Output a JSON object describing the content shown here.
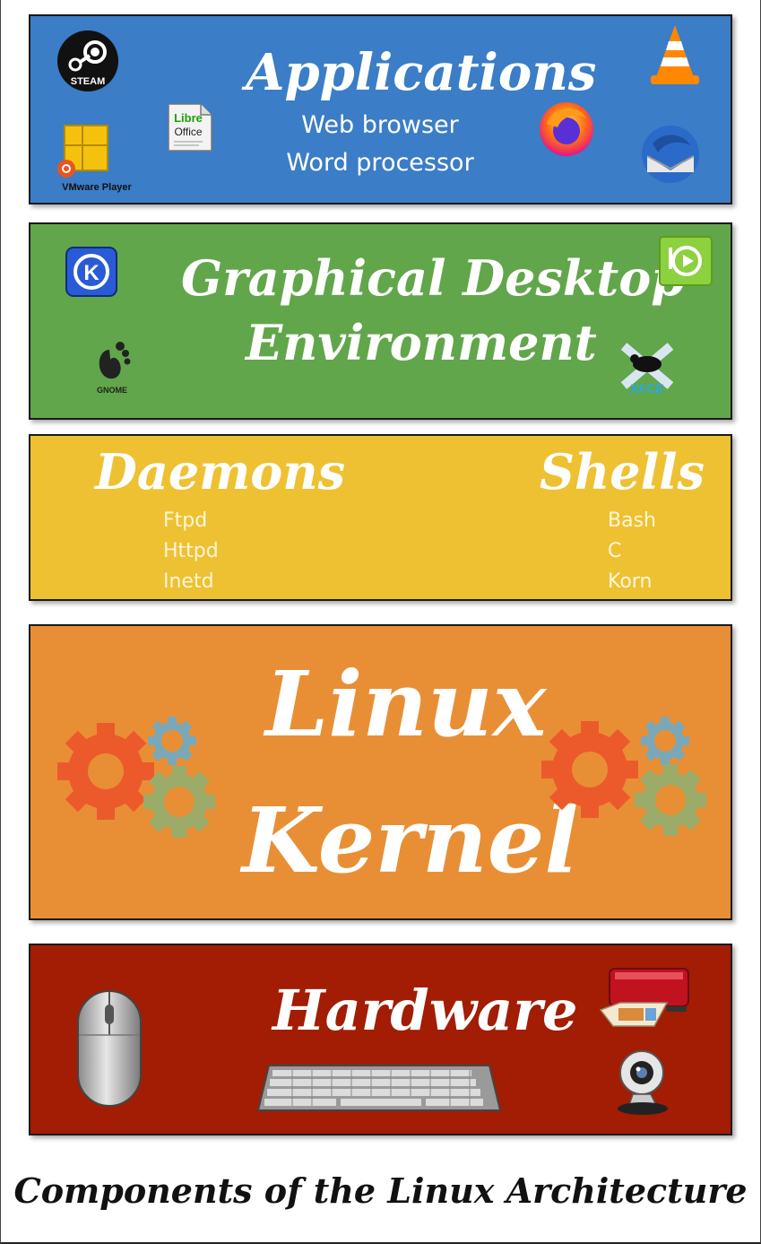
{
  "applications": {
    "title": "Applications",
    "items": [
      "Web browser",
      "Word processor"
    ],
    "steam_label": "STEAM",
    "libre_label": "Libre",
    "office_label": "Office",
    "vmware_label": "VMware Player",
    "color": "#3b7dc6"
  },
  "desktop": {
    "title_line1": "Graphical Desktop",
    "title_line2": "Environment",
    "gnome_label": "GNOME",
    "xfce_label": "XFCE",
    "color": "#62a64b"
  },
  "daemons": {
    "title": "Daemons",
    "items": [
      "Ftpd",
      "Httpd",
      "Inetd"
    ]
  },
  "shells": {
    "title": "Shells",
    "items": [
      "Bash",
      "C",
      "Korn"
    ]
  },
  "middle_color": "#eec133",
  "kernel": {
    "title_line1": "Linux",
    "title_line2": "Kernel",
    "color": "#e88f36"
  },
  "hardware": {
    "title": "Hardware",
    "color": "#a21d04"
  },
  "caption": "Components of the Linux Architecture",
  "icons": [
    "steam-icon",
    "vmware-icon",
    "libreoffice-icon",
    "vlc-icon",
    "firefox-icon",
    "thunderbird-icon",
    "kde-icon",
    "mint-icon",
    "gnome-icon",
    "xfce-icon",
    "gear-icon",
    "mouse-icon",
    "keyboard-icon",
    "printer-icon",
    "webcam-icon"
  ]
}
